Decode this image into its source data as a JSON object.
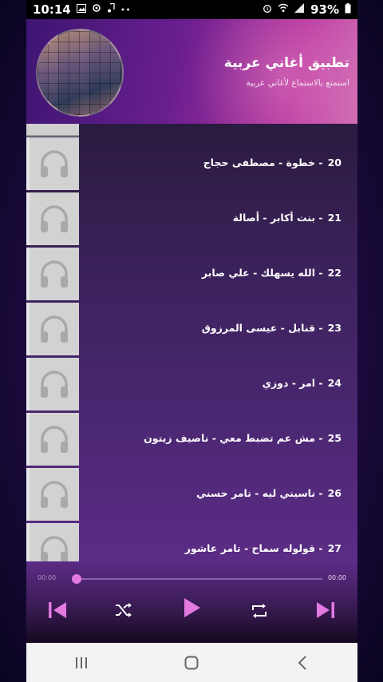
{
  "status_bar": {
    "time": "10:14",
    "battery": "93%",
    "notification_icons": [
      "image-icon",
      "settings-icon",
      "music-note-icon",
      "more-dots-icon"
    ],
    "system_icons": [
      "alarm-icon",
      "wifi-icon",
      "signal-icon",
      "battery-icon"
    ]
  },
  "header": {
    "title": "تطبيق أغاني عربية",
    "subtitle": "استمتع بالاستماع لأغاني عربية"
  },
  "songs": [
    {
      "num": "20",
      "title": "خطوة - مصطفى حجاج"
    },
    {
      "num": "21",
      "title": "بنت أكابر - أصالة"
    },
    {
      "num": "22",
      "title": "الله يسهلك - علي صابر"
    },
    {
      "num": "23",
      "title": "قنابل - عيسى المرزوق"
    },
    {
      "num": "24",
      "title": "امر - دوزي"
    },
    {
      "num": "25",
      "title": "مش عم تضبط معي - ناصيف زيتون"
    },
    {
      "num": "26",
      "title": "ناسيني ليه - تامر حسني"
    },
    {
      "num": "27",
      "title": "قولوله سماح - تامر عاشور"
    }
  ],
  "player": {
    "elapsed": "00:00",
    "duration": "00:00",
    "progress": 0,
    "controls": [
      "previous-icon",
      "shuffle-icon",
      "play-icon",
      "repeat-icon",
      "next-icon"
    ]
  },
  "nav_bar": [
    "recent-apps-icon",
    "home-icon",
    "back-icon"
  ],
  "colors": {
    "accent": "#e27ae0",
    "header_start": "#3d1572",
    "header_end": "#d06bb4",
    "list_bg": "#3e2360"
  }
}
